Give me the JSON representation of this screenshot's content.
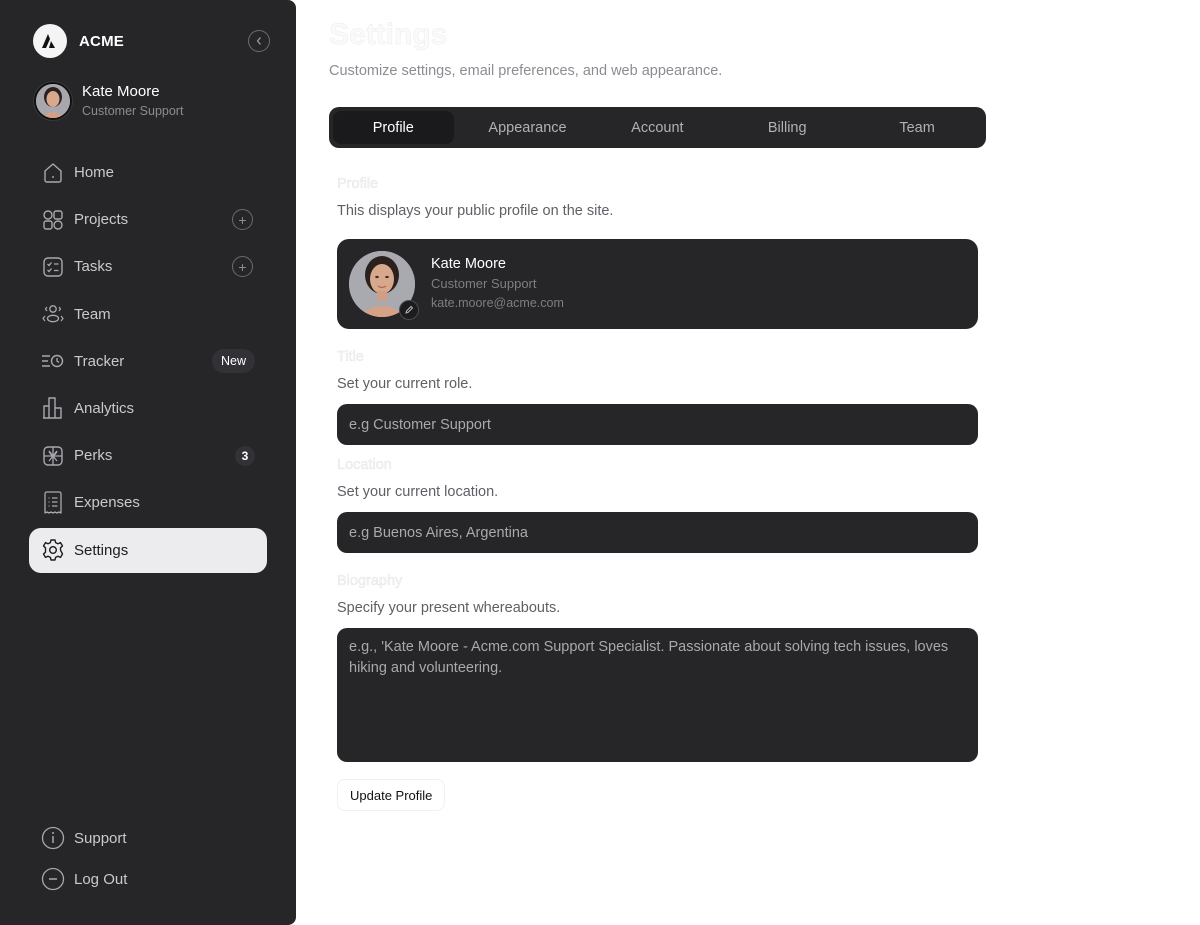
{
  "brand": {
    "name": "ACME",
    "logo_icon": "acme-triangle-logo"
  },
  "sidebar": {
    "collapse_icon": "chevron-left-icon",
    "user": {
      "name": "Kate Moore",
      "role": "Customer Support"
    },
    "items": [
      {
        "label": "Home",
        "icon": "home-icon"
      },
      {
        "label": "Projects",
        "icon": "grid-icon",
        "action": "+"
      },
      {
        "label": "Tasks",
        "icon": "checklist-icon",
        "action": "+"
      },
      {
        "label": "Team",
        "icon": "team-icon"
      },
      {
        "label": "Tracker",
        "icon": "tracker-icon",
        "badge": "New"
      },
      {
        "label": "Analytics",
        "icon": "bar-chart-icon"
      },
      {
        "label": "Perks",
        "icon": "gift-icon",
        "count": "3"
      },
      {
        "label": "Expenses",
        "icon": "receipt-icon"
      },
      {
        "label": "Settings",
        "icon": "gear-icon",
        "active": true
      }
    ],
    "bottom": [
      {
        "label": "Support",
        "icon": "info-icon"
      },
      {
        "label": "Log Out",
        "icon": "logout-icon"
      }
    ]
  },
  "header": {
    "title": "Settings",
    "subtitle": "Customize settings, email preferences, and web appearance."
  },
  "tabs": [
    {
      "label": "Profile",
      "active": true
    },
    {
      "label": "Appearance"
    },
    {
      "label": "Account"
    },
    {
      "label": "Billing"
    },
    {
      "label": "Team"
    }
  ],
  "profile": {
    "label": "Profile",
    "description": "This displays your public profile on the site.",
    "card": {
      "name": "Kate Moore",
      "role": "Customer Support",
      "email": "kate.moore@acme.com"
    }
  },
  "title_field": {
    "label": "Title",
    "description": "Set your current role.",
    "placeholder": "e.g Customer Support",
    "value": ""
  },
  "location_field": {
    "label": "Location",
    "description": "Set your current location.",
    "placeholder": "e.g Buenos Aires, Argentina",
    "value": ""
  },
  "biography_field": {
    "label": "Biography",
    "description": "Specify your present whereabouts.",
    "placeholder": "e.g., 'Kate Moore - Acme.com Support Specialist. Passionate about solving tech issues, loves hiking and volunteering.",
    "value": ""
  },
  "actions": {
    "update_label": "Update Profile"
  }
}
